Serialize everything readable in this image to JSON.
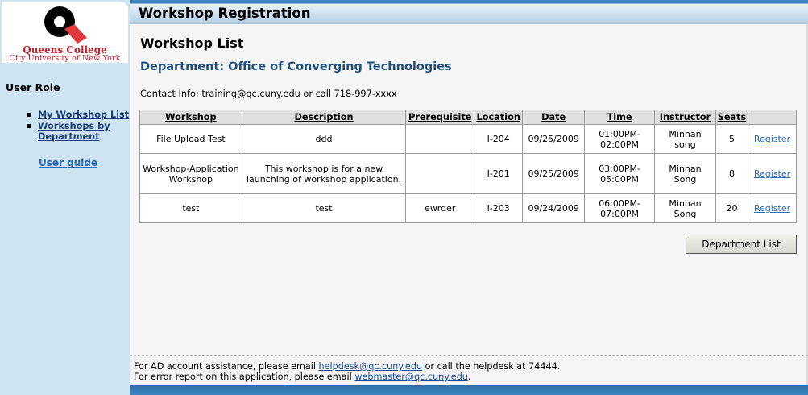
{
  "logo": {
    "name_line1": "Queens College",
    "name_line2": "City University of New York"
  },
  "sidebar": {
    "heading": "User Role",
    "items": [
      {
        "label": "My Workshop List"
      },
      {
        "label": "Workshops by Department"
      }
    ],
    "user_guide": "User guide"
  },
  "header": {
    "title": "Workshop Registration"
  },
  "main": {
    "title": "Workshop List",
    "department": "Department: Office of Converging Technologies",
    "contact": "Contact Info: training@qc.cuny.edu or call 718-997-xxxx",
    "table": {
      "headers": [
        "Workshop",
        "Description",
        "Prerequisite",
        "Location",
        "Date",
        "Time",
        "Instructor",
        "Seats",
        ""
      ],
      "rows": [
        {
          "workshop": "File Upload Test",
          "description": "ddd",
          "prerequisite": "",
          "location": "I-204",
          "date": "09/25/2009",
          "time": "01:00PM-02:00PM",
          "instructor": "Minhan song",
          "seats": "5",
          "action": "Register"
        },
        {
          "workshop": "Workshop-Application Workshop",
          "description": "This workshop is for a new launching of workshop application.",
          "prerequisite": "",
          "location": "I-201",
          "date": "09/25/2009",
          "time": "03:00PM-05:00PM",
          "instructor": "Minhan Song",
          "seats": "8",
          "action": "Register"
        },
        {
          "workshop": "test",
          "description": "test",
          "prerequisite": "ewrqer",
          "location": "I-203",
          "date": "09/24/2009",
          "time": "06:00PM-07:00PM",
          "instructor": "Minhan Song",
          "seats": "20",
          "action": "Register"
        }
      ]
    },
    "dept_list_button": "Department List"
  },
  "footer": {
    "line1_a": "For AD account assistance, please email ",
    "line1_link": "helpdesk@qc.cuny.edu",
    "line1_b": " or call the helpdesk at 74444.",
    "line2_a": "For error report on this application, please email ",
    "line2_link": "webmaster@qc.cuny.edu",
    "line2_b": "."
  },
  "colors": {
    "header_blue": "#2f6fa7",
    "sidebar_bg": "#cfe4f2",
    "logo_red": "#c0202a",
    "link_blue": "#2968b3"
  }
}
